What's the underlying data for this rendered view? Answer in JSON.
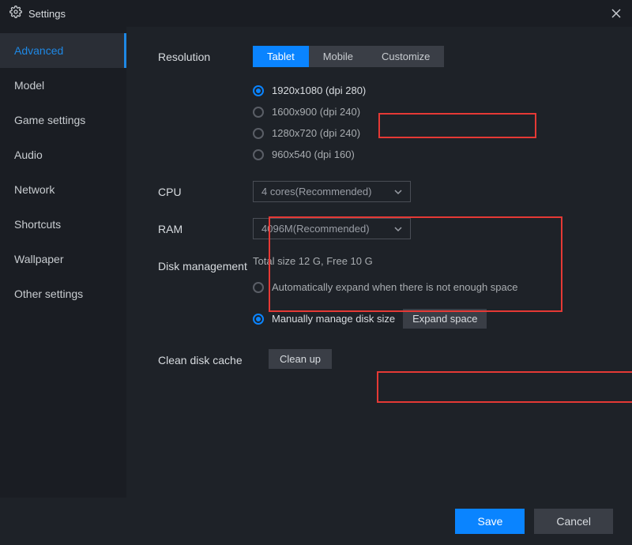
{
  "titlebar": {
    "title": "Settings"
  },
  "sidebar": {
    "items": [
      {
        "label": "Advanced"
      },
      {
        "label": "Model"
      },
      {
        "label": "Game settings"
      },
      {
        "label": "Audio"
      },
      {
        "label": "Network"
      },
      {
        "label": "Shortcuts"
      },
      {
        "label": "Wallpaper"
      },
      {
        "label": "Other settings"
      }
    ]
  },
  "resolution": {
    "label": "Resolution",
    "tabs": {
      "tablet": "Tablet",
      "mobile": "Mobile",
      "customize": "Customize"
    },
    "options": [
      "1920x1080  (dpi 280)",
      "1600x900  (dpi 240)",
      "1280x720  (dpi 240)",
      "960x540  (dpi 160)"
    ]
  },
  "cpu": {
    "label": "CPU",
    "value": "4 cores(Recommended)"
  },
  "ram": {
    "label": "RAM",
    "value": "4096M(Recommended)"
  },
  "disk": {
    "label": "Disk management",
    "info": "Total size 12 G,   Free 10 G",
    "auto": "Automatically expand when there is not enough space",
    "manual": "Manually manage disk size",
    "expand": "Expand space"
  },
  "clean": {
    "label": "Clean disk cache",
    "button": "Clean up"
  },
  "footer": {
    "save": "Save",
    "cancel": "Cancel"
  }
}
